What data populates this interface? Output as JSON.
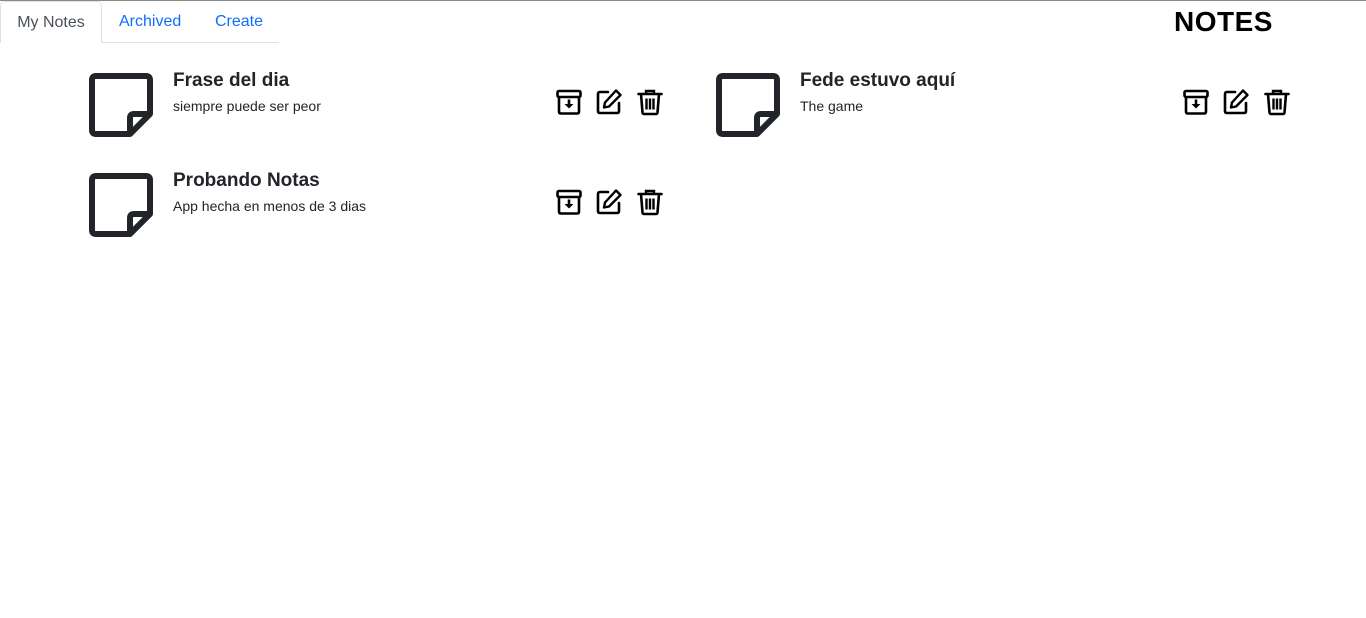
{
  "tabs": [
    {
      "label": "My Notes",
      "active": true
    },
    {
      "label": "Archived",
      "active": false
    },
    {
      "label": "Create",
      "active": false
    }
  ],
  "app_title": "NOTES",
  "notes": [
    {
      "title": "Frase del dia",
      "text": "siempre puede ser peor"
    },
    {
      "title": "Fede estuvo aquí",
      "text": "The game"
    },
    {
      "title": "Probando Notas",
      "text": "App hecha en menos de 3 dias"
    }
  ],
  "icons": {
    "note": "sticky-note-icon",
    "archive": "archive-icon",
    "edit": "edit-icon",
    "delete": "trash-icon"
  },
  "colors": {
    "link": "#0d6efd",
    "active_tab_text": "#495057",
    "text": "#212529"
  }
}
